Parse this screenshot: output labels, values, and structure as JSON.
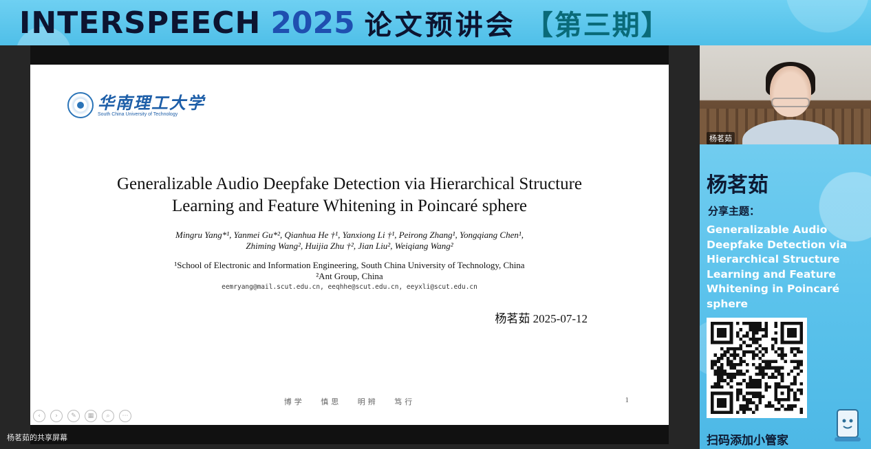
{
  "banner": {
    "part1": "INTERSPEECH",
    "part2": "2025",
    "part3": "论文预讲会",
    "part4": "【第三期】"
  },
  "slide": {
    "logo_cn": "华南理工大学",
    "logo_en": "South China University of Technology",
    "title_line1": "Generalizable Audio Deepfake Detection via Hierarchical Structure",
    "title_line2": "Learning and Feature Whitening in Poincaré sphere",
    "authors_line1": "Mingru Yang*¹, Yanmei Gu*², Qianhua He †¹, Yanxiong Li †¹, Peirong Zhang¹, Yongqiang Chen¹,",
    "authors_line2": "Zhiming Wang², Huijia Zhu †², Jian Liu², Weiqiang Wang²",
    "affil_line1": "¹School of Electronic and Information Engineering, South China University of Technology, China",
    "affil_line2": "²Ant Group, China",
    "emails": "eemryang@mail.scut.edu.cn, eeqhhe@scut.edu.cn, eeyxli@scut.edu.cn",
    "presenter_date": "杨茗茹 2025-07-12",
    "motto": [
      "博学",
      "慎思",
      "明辨",
      "笃行"
    ],
    "page_number": "1"
  },
  "share_label": "杨茗茹的共享屏幕",
  "side": {
    "webcam_name": "杨茗茹",
    "speaker_name": "杨茗茹",
    "topic_label": "分享主题：",
    "topic": "Generalizable Audio Deepfake Detection via Hierarchical Structure Learning and Feature Whitening in Poincaré sphere",
    "scan_text": "扫码添加小管家"
  },
  "icons": {
    "slide_controls": [
      "prev-icon",
      "next-icon",
      "pen-icon",
      "grid-icon",
      "zoom-icon",
      "more-icon"
    ]
  }
}
